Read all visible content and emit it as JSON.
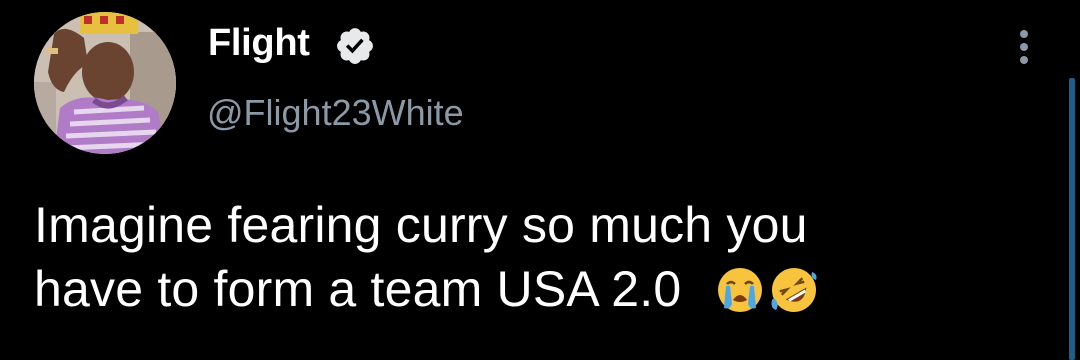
{
  "tweet": {
    "author": {
      "display_name": "Flight",
      "handle": "@Flight23White",
      "verified": true
    },
    "text_lines": [
      "Imagine fearing curry so much you",
      "have to form a team USA 2.0"
    ],
    "emojis": [
      "crying-face",
      "rolling-on-floor-laughing"
    ]
  },
  "icons": {
    "verified": "verified-badge-icon",
    "more": "more-options-vertical-icon"
  },
  "colors": {
    "background": "#000000",
    "text_primary": "#ffffff",
    "text_secondary": "#8b98a5",
    "scroll_indicator": "#1d5f86"
  }
}
